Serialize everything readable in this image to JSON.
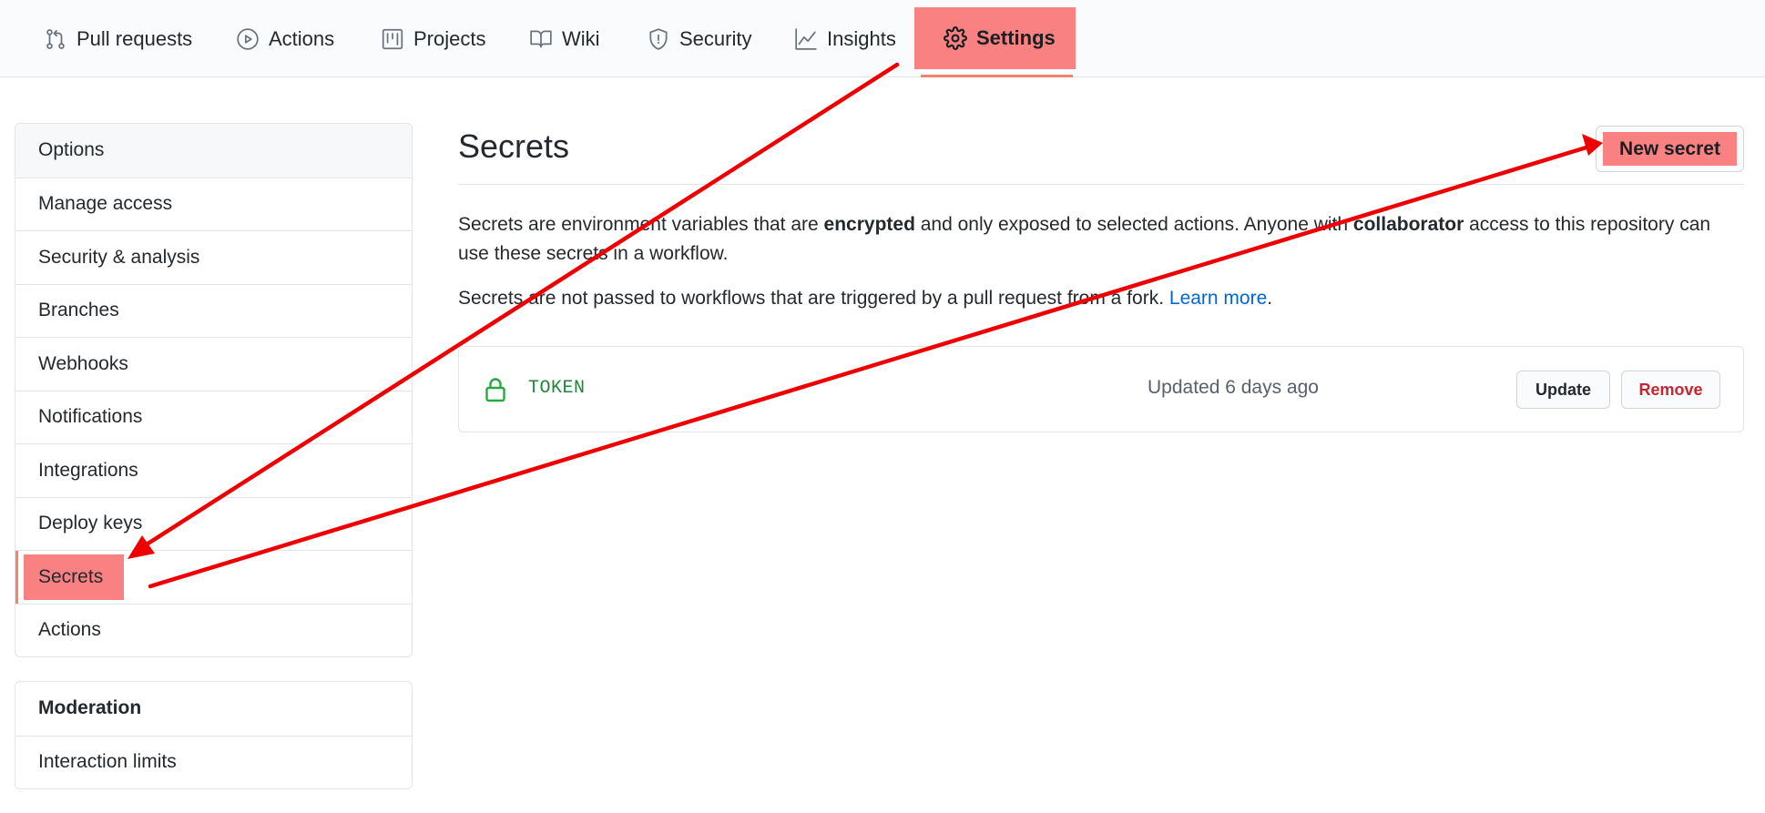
{
  "nav": {
    "tabs": [
      {
        "label": "Pull requests",
        "icon": "git-pull-request-icon"
      },
      {
        "label": "Actions",
        "icon": "play-icon"
      },
      {
        "label": "Projects",
        "icon": "project-icon"
      },
      {
        "label": "Wiki",
        "icon": "book-icon"
      },
      {
        "label": "Security",
        "icon": "shield-icon"
      },
      {
        "label": "Insights",
        "icon": "graph-icon"
      },
      {
        "label": "Settings",
        "icon": "gear-icon",
        "selected": true
      }
    ]
  },
  "sidebar": {
    "items": [
      {
        "label": "Options"
      },
      {
        "label": "Manage access"
      },
      {
        "label": "Security & analysis"
      },
      {
        "label": "Branches"
      },
      {
        "label": "Webhooks"
      },
      {
        "label": "Notifications"
      },
      {
        "label": "Integrations"
      },
      {
        "label": "Deploy keys"
      },
      {
        "label": "Secrets",
        "selected": true
      },
      {
        "label": "Actions"
      }
    ],
    "moderation": {
      "heading": "Moderation",
      "items": [
        {
          "label": "Interaction limits"
        }
      ]
    }
  },
  "main": {
    "title": "Secrets",
    "new_secret_label": "New secret",
    "description": {
      "part1": "Secrets are environment variables that are ",
      "bold1": "encrypted",
      "part2": " and only exposed to selected actions. Anyone with ",
      "bold2": "collaborator",
      "part3": " access to this repository can use these secrets in a workflow."
    },
    "note": {
      "text": "Secrets are not passed to workflows that are triggered by a pull request from a fork. ",
      "link": "Learn more",
      "end": "."
    },
    "secrets": [
      {
        "name": "TOKEN",
        "updated": "Updated 6 days ago",
        "update_label": "Update",
        "remove_label": "Remove"
      }
    ]
  },
  "colors": {
    "highlight": "#fa8181",
    "arrow": "#ee0000",
    "link": "#0366d6",
    "secret_name": "#22863a",
    "danger": "#cb2431"
  }
}
